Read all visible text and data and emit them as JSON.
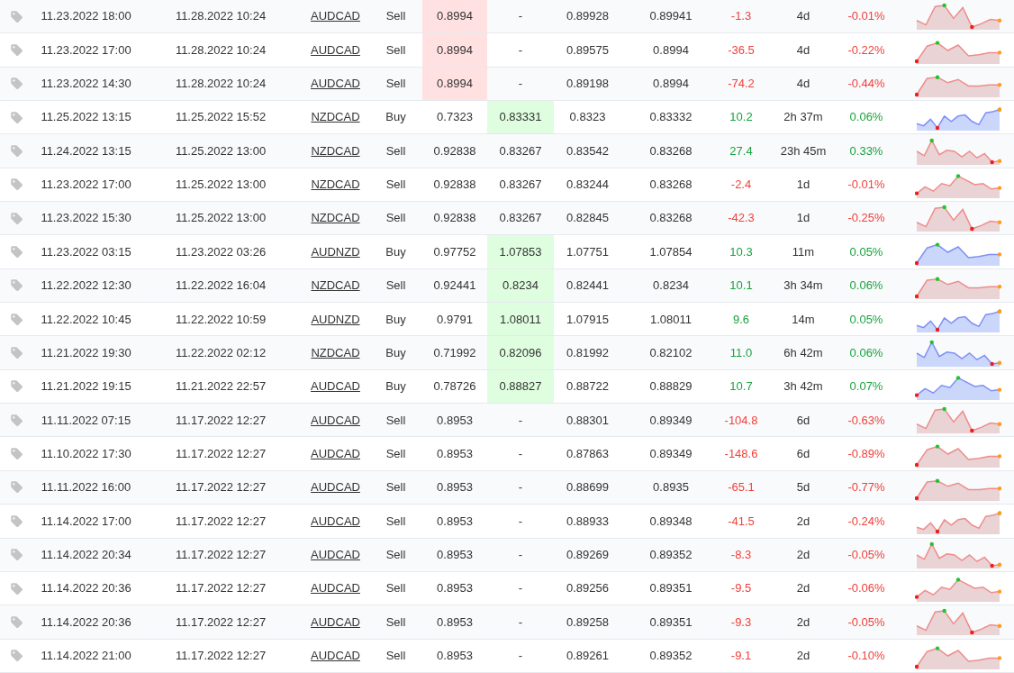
{
  "rows": [
    {
      "kind": "sell",
      "gain": false,
      "open_time": "11.23.2022 18:00",
      "close_time": "11.28.2022 10:24",
      "symbol": "AUDCAD",
      "type": "Sell",
      "stop_loss": {
        "value": "0.8994",
        "hit": true
      },
      "take_profit": {
        "value": "-",
        "hit": false
      },
      "open_price": "0.89928",
      "close_price": "0.89941",
      "pips": "-1.3",
      "duration": "4d",
      "change": "-0.01%"
    },
    {
      "kind": "sell",
      "gain": false,
      "open_time": "11.23.2022 17:00",
      "close_time": "11.28.2022 10:24",
      "symbol": "AUDCAD",
      "type": "Sell",
      "stop_loss": {
        "value": "0.8994",
        "hit": true
      },
      "take_profit": {
        "value": "-",
        "hit": false
      },
      "open_price": "0.89575",
      "close_price": "0.8994",
      "pips": "-36.5",
      "duration": "4d",
      "change": "-0.22%"
    },
    {
      "kind": "sell",
      "gain": false,
      "open_time": "11.23.2022 14:30",
      "close_time": "11.28.2022 10:24",
      "symbol": "AUDCAD",
      "type": "Sell",
      "stop_loss": {
        "value": "0.8994",
        "hit": true
      },
      "take_profit": {
        "value": "-",
        "hit": false
      },
      "open_price": "0.89198",
      "close_price": "0.8994",
      "pips": "-74.2",
      "duration": "4d",
      "change": "-0.44%"
    },
    {
      "kind": "buy",
      "gain": true,
      "open_time": "11.25.2022 13:15",
      "close_time": "11.25.2022 15:52",
      "symbol": "NZDCAD",
      "type": "Buy",
      "stop_loss": {
        "value": "0.7323",
        "hit": false
      },
      "take_profit": {
        "value": "0.83331",
        "hit": true
      },
      "open_price": "0.8323",
      "close_price": "0.83332",
      "pips": "10.2",
      "duration": "2h 37m",
      "change": "0.06%"
    },
    {
      "kind": "sell",
      "gain": true,
      "open_time": "11.24.2022 13:15",
      "close_time": "11.25.2022 13:00",
      "symbol": "NZDCAD",
      "type": "Sell",
      "stop_loss": {
        "value": "0.92838",
        "hit": false
      },
      "take_profit": {
        "value": "0.83267",
        "hit": false
      },
      "open_price": "0.83542",
      "close_price": "0.83268",
      "pips": "27.4",
      "duration": "23h 45m",
      "change": "0.33%"
    },
    {
      "kind": "sell",
      "gain": false,
      "open_time": "11.23.2022 17:00",
      "close_time": "11.25.2022 13:00",
      "symbol": "NZDCAD",
      "type": "Sell",
      "stop_loss": {
        "value": "0.92838",
        "hit": false
      },
      "take_profit": {
        "value": "0.83267",
        "hit": false
      },
      "open_price": "0.83244",
      "close_price": "0.83268",
      "pips": "-2.4",
      "duration": "1d",
      "change": "-0.01%"
    },
    {
      "kind": "sell",
      "gain": false,
      "open_time": "11.23.2022 15:30",
      "close_time": "11.25.2022 13:00",
      "symbol": "NZDCAD",
      "type": "Sell",
      "stop_loss": {
        "value": "0.92838",
        "hit": false
      },
      "take_profit": {
        "value": "0.83267",
        "hit": false
      },
      "open_price": "0.82845",
      "close_price": "0.83268",
      "pips": "-42.3",
      "duration": "1d",
      "change": "-0.25%"
    },
    {
      "kind": "buy",
      "gain": true,
      "open_time": "11.23.2022 03:15",
      "close_time": "11.23.2022 03:26",
      "symbol": "AUDNZD",
      "type": "Buy",
      "stop_loss": {
        "value": "0.97752",
        "hit": false
      },
      "take_profit": {
        "value": "1.07853",
        "hit": true
      },
      "open_price": "1.07751",
      "close_price": "1.07854",
      "pips": "10.3",
      "duration": "11m",
      "change": "0.05%"
    },
    {
      "kind": "sell",
      "gain": true,
      "open_time": "11.22.2022 12:30",
      "close_time": "11.22.2022 16:04",
      "symbol": "NZDCAD",
      "type": "Sell",
      "stop_loss": {
        "value": "0.92441",
        "hit": false
      },
      "take_profit": {
        "value": "0.8234",
        "hit": true
      },
      "open_price": "0.82441",
      "close_price": "0.8234",
      "pips": "10.1",
      "duration": "3h 34m",
      "change": "0.06%"
    },
    {
      "kind": "buy",
      "gain": true,
      "open_time": "11.22.2022 10:45",
      "close_time": "11.22.2022 10:59",
      "symbol": "AUDNZD",
      "type": "Buy",
      "stop_loss": {
        "value": "0.9791",
        "hit": false
      },
      "take_profit": {
        "value": "1.08011",
        "hit": true
      },
      "open_price": "1.07915",
      "close_price": "1.08011",
      "pips": "9.6",
      "duration": "14m",
      "change": "0.05%"
    },
    {
      "kind": "buy",
      "gain": true,
      "open_time": "11.21.2022 19:30",
      "close_time": "11.22.2022 02:12",
      "symbol": "NZDCAD",
      "type": "Buy",
      "stop_loss": {
        "value": "0.71992",
        "hit": false
      },
      "take_profit": {
        "value": "0.82096",
        "hit": true
      },
      "open_price": "0.81992",
      "close_price": "0.82102",
      "pips": "11.0",
      "duration": "6h 42m",
      "change": "0.06%"
    },
    {
      "kind": "buy",
      "gain": true,
      "open_time": "11.21.2022 19:15",
      "close_time": "11.21.2022 22:57",
      "symbol": "AUDCAD",
      "type": "Buy",
      "stop_loss": {
        "value": "0.78726",
        "hit": false
      },
      "take_profit": {
        "value": "0.88827",
        "hit": true
      },
      "open_price": "0.88722",
      "close_price": "0.88829",
      "pips": "10.7",
      "duration": "3h 42m",
      "change": "0.07%"
    },
    {
      "kind": "sell",
      "gain": false,
      "open_time": "11.11.2022 07:15",
      "close_time": "11.17.2022 12:27",
      "symbol": "AUDCAD",
      "type": "Sell",
      "stop_loss": {
        "value": "0.8953",
        "hit": false
      },
      "take_profit": {
        "value": "-",
        "hit": false
      },
      "open_price": "0.88301",
      "close_price": "0.89349",
      "pips": "-104.8",
      "duration": "6d",
      "change": "-0.63%"
    },
    {
      "kind": "sell",
      "gain": false,
      "open_time": "11.10.2022 17:30",
      "close_time": "11.17.2022 12:27",
      "symbol": "AUDCAD",
      "type": "Sell",
      "stop_loss": {
        "value": "0.8953",
        "hit": false
      },
      "take_profit": {
        "value": "-",
        "hit": false
      },
      "open_price": "0.87863",
      "close_price": "0.89349",
      "pips": "-148.6",
      "duration": "6d",
      "change": "-0.89%"
    },
    {
      "kind": "sell",
      "gain": false,
      "open_time": "11.11.2022 16:00",
      "close_time": "11.17.2022 12:27",
      "symbol": "AUDCAD",
      "type": "Sell",
      "stop_loss": {
        "value": "0.8953",
        "hit": false
      },
      "take_profit": {
        "value": "-",
        "hit": false
      },
      "open_price": "0.88699",
      "close_price": "0.8935",
      "pips": "-65.1",
      "duration": "5d",
      "change": "-0.77%"
    },
    {
      "kind": "sell",
      "gain": false,
      "open_time": "11.14.2022 17:00",
      "close_time": "11.17.2022 12:27",
      "symbol": "AUDCAD",
      "type": "Sell",
      "stop_loss": {
        "value": "0.8953",
        "hit": false
      },
      "take_profit": {
        "value": "-",
        "hit": false
      },
      "open_price": "0.88933",
      "close_price": "0.89348",
      "pips": "-41.5",
      "duration": "2d",
      "change": "-0.24%"
    },
    {
      "kind": "sell",
      "gain": false,
      "open_time": "11.14.2022 20:34",
      "close_time": "11.17.2022 12:27",
      "symbol": "AUDCAD",
      "type": "Sell",
      "stop_loss": {
        "value": "0.8953",
        "hit": false
      },
      "take_profit": {
        "value": "-",
        "hit": false
      },
      "open_price": "0.89269",
      "close_price": "0.89352",
      "pips": "-8.3",
      "duration": "2d",
      "change": "-0.05%"
    },
    {
      "kind": "sell",
      "gain": false,
      "open_time": "11.14.2022 20:36",
      "close_time": "11.17.2022 12:27",
      "symbol": "AUDCAD",
      "type": "Sell",
      "stop_loss": {
        "value": "0.8953",
        "hit": false
      },
      "take_profit": {
        "value": "-",
        "hit": false
      },
      "open_price": "0.89256",
      "close_price": "0.89351",
      "pips": "-9.5",
      "duration": "2d",
      "change": "-0.06%"
    },
    {
      "kind": "sell",
      "gain": false,
      "open_time": "11.14.2022 20:36",
      "close_time": "11.17.2022 12:27",
      "symbol": "AUDCAD",
      "type": "Sell",
      "stop_loss": {
        "value": "0.8953",
        "hit": false
      },
      "take_profit": {
        "value": "-",
        "hit": false
      },
      "open_price": "0.89258",
      "close_price": "0.89351",
      "pips": "-9.3",
      "duration": "2d",
      "change": "-0.05%"
    },
    {
      "kind": "sell",
      "gain": false,
      "open_time": "11.14.2022 21:00",
      "close_time": "11.17.2022 12:27",
      "symbol": "AUDCAD",
      "type": "Sell",
      "stop_loss": {
        "value": "0.8953",
        "hit": false
      },
      "take_profit": {
        "value": "-",
        "hit": false
      },
      "open_price": "0.89261",
      "close_price": "0.89352",
      "pips": "-9.1",
      "duration": "2d",
      "change": "-0.10%"
    }
  ]
}
